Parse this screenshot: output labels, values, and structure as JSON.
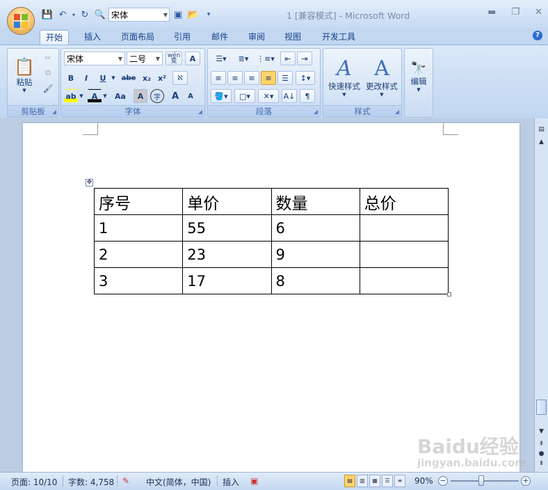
{
  "title_bar": {
    "title": "1 [兼容模式] - Microsoft Word",
    "font_quick": "宋体",
    "minimize": "▬",
    "maximize": "❐",
    "close": "✕"
  },
  "tabs": [
    {
      "label": "开始",
      "active": true
    },
    {
      "label": "插入"
    },
    {
      "label": "页面布局"
    },
    {
      "label": "引用"
    },
    {
      "label": "邮件"
    },
    {
      "label": "审阅"
    },
    {
      "label": "视图"
    },
    {
      "label": "开发工具"
    }
  ],
  "ribbon": {
    "clipboard": {
      "label": "剪贴板",
      "paste": "粘贴"
    },
    "font": {
      "label": "字体",
      "font_name": "宋体",
      "font_size": "二号",
      "wen": "wén\n变",
      "bold": "B",
      "italic": "I",
      "underline": "U",
      "strike": "abe",
      "sub": "x₂",
      "sup": "x²",
      "highlight": "ab",
      "color": "A",
      "case": "Aa",
      "shade": "A",
      "enclose": "字",
      "grow": "A",
      "shrink": "A"
    },
    "paragraph": {
      "label": "段落"
    },
    "styles": {
      "label": "样式",
      "quick": "快速样式",
      "change": "更改样式"
    },
    "edit": {
      "label": "编辑"
    }
  },
  "table": {
    "headers": [
      "序号",
      "单价",
      "数量",
      "总价"
    ],
    "rows": [
      [
        "1",
        "55",
        "6",
        ""
      ],
      [
        "2",
        "23",
        "9",
        ""
      ],
      [
        "3",
        "17",
        "8",
        ""
      ]
    ]
  },
  "status": {
    "page": "页面: 10/10",
    "words": "字数: 4,758",
    "language": "中文(简体，中国)",
    "mode": "插入",
    "zoom": "90%"
  },
  "watermark": {
    "text": "Baidu经验",
    "sub": "jingyan.baidu.com"
  }
}
